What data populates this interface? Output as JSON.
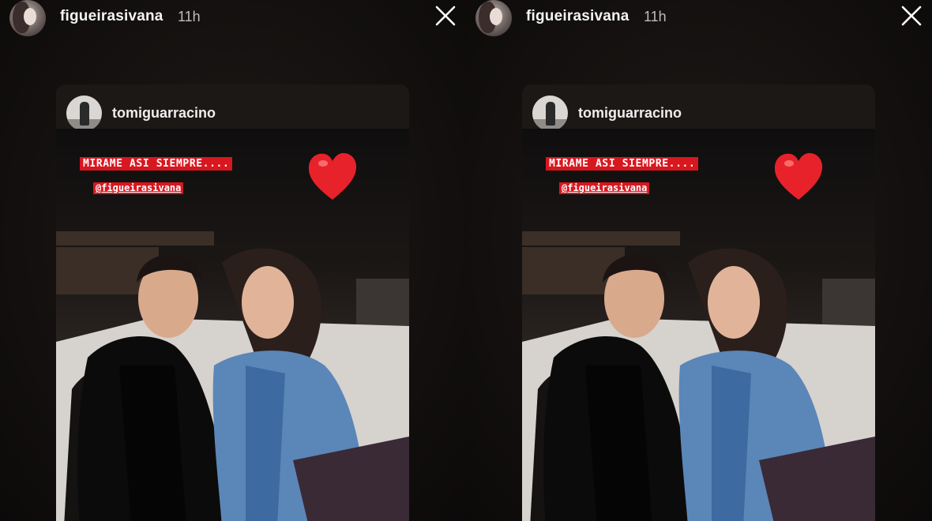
{
  "story_viewer": {
    "poster": {
      "username": "figueirasivana",
      "time": "11h"
    },
    "close_icon": "close-icon",
    "shared_post": {
      "username": "tomiguarracino",
      "caption": "MIRAME ASI SIEMPRE....",
      "mention": "@figueirasivana",
      "sticker": "heart-emoji"
    }
  },
  "colors": {
    "caption_bg": "#d8171f",
    "heart": "#e8222a",
    "background": "#0e0c0b"
  }
}
